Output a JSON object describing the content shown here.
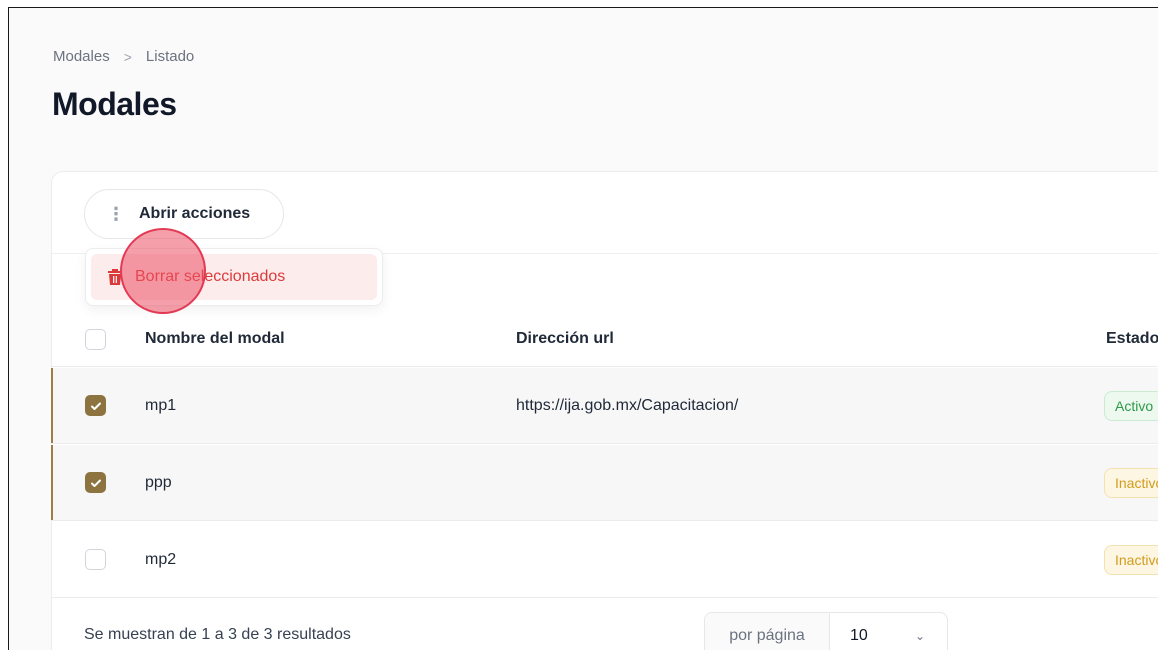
{
  "breadcrumb": {
    "items": [
      "Modales",
      "Listado"
    ],
    "separator": ">"
  },
  "page": {
    "title": "Modales"
  },
  "toolbar": {
    "actions_label": "Abrir acciones",
    "actions_icon": "vertical-dots-icon"
  },
  "dropdown": {
    "items": [
      {
        "label": "Borrar seleccionados",
        "icon": "trash-icon",
        "color": "#dc3a3a"
      }
    ]
  },
  "table": {
    "columns": [
      "Nombre del modal",
      "Dirección url",
      "Estado"
    ],
    "rows": [
      {
        "name": "mp1",
        "url": "https://ija.gob.mx/Capacitacion/",
        "status": "Activo",
        "checked": true
      },
      {
        "name": "ppp",
        "url": "",
        "status": "Inactivo",
        "checked": true
      },
      {
        "name": "mp2",
        "url": "",
        "status": "Inactivo",
        "checked": false
      }
    ]
  },
  "footer": {
    "results_text": "Se muestran de 1 a 3 de 3 resultados",
    "per_page_label": "por página",
    "per_page_value": "10"
  },
  "colors": {
    "accent": "#8d7340",
    "danger": "#dc3a3a",
    "active": "#2e9a4a",
    "inactive": "#d39c1c"
  }
}
